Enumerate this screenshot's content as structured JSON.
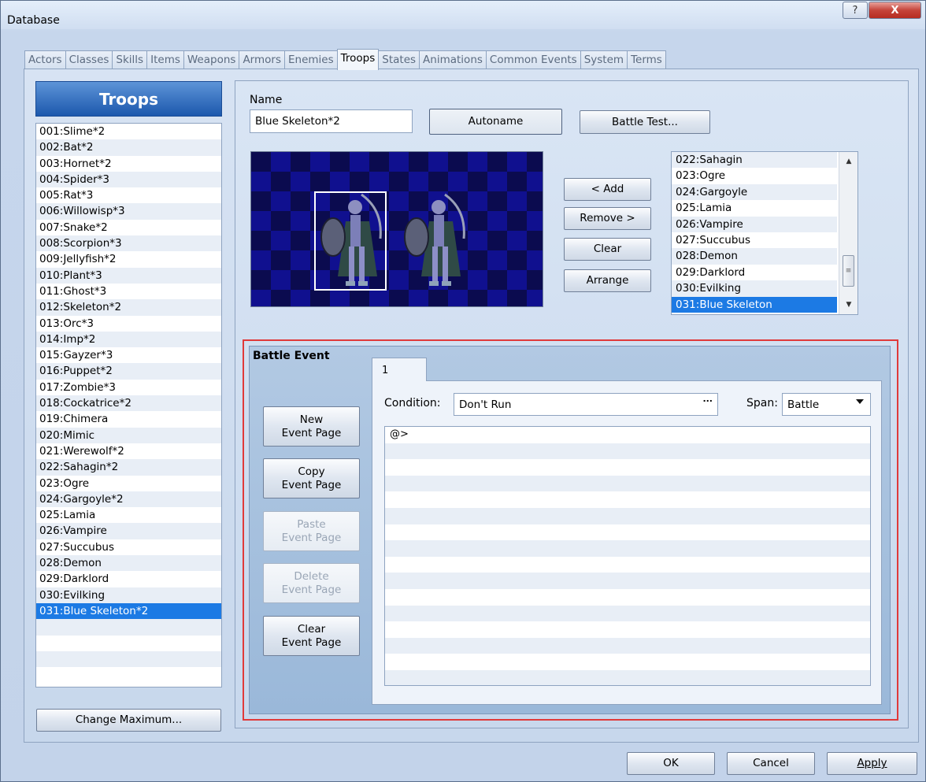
{
  "window": {
    "title": "Database",
    "help_label": "?",
    "close_label": "X"
  },
  "tabs": [
    {
      "label": "Actors",
      "active": false
    },
    {
      "label": "Classes",
      "active": false
    },
    {
      "label": "Skills",
      "active": false
    },
    {
      "label": "Items",
      "active": false
    },
    {
      "label": "Weapons",
      "active": false
    },
    {
      "label": "Armors",
      "active": false
    },
    {
      "label": "Enemies",
      "active": false
    },
    {
      "label": "Troops",
      "active": true
    },
    {
      "label": "States",
      "active": false
    },
    {
      "label": "Animations",
      "active": false
    },
    {
      "label": "Common Events",
      "active": false
    },
    {
      "label": "System",
      "active": false
    },
    {
      "label": "Terms",
      "active": false
    }
  ],
  "troop_list": {
    "header": "Troops",
    "items": [
      "001:Slime*2",
      "002:Bat*2",
      "003:Hornet*2",
      "004:Spider*3",
      "005:Rat*3",
      "006:Willowisp*3",
      "007:Snake*2",
      "008:Scorpion*3",
      "009:Jellyfish*2",
      "010:Plant*3",
      "011:Ghost*3",
      "012:Skeleton*2",
      "013:Orc*3",
      "014:Imp*2",
      "015:Gayzer*3",
      "016:Puppet*2",
      "017:Zombie*3",
      "018:Cockatrice*2",
      "019:Chimera",
      "020:Mimic",
      "021:Werewolf*2",
      "022:Sahagin*2",
      "023:Ogre",
      "024:Gargoyle*2",
      "025:Lamia",
      "026:Vampire",
      "027:Succubus",
      "028:Demon",
      "029:Darklord",
      "030:Evilking",
      "031:Blue Skeleton*2"
    ],
    "selected_index": 30,
    "change_max_label": "Change Maximum..."
  },
  "troop_editor": {
    "name_label": "Name",
    "name_value": "Blue Skeleton*2",
    "autoname_label": "Autoname",
    "battle_test_label": "Battle Test...",
    "add_label": "< Add",
    "remove_label": "Remove >",
    "clear_label": "Clear",
    "arrange_label": "Arrange"
  },
  "enemy_list": {
    "items": [
      "022:Sahagin",
      "023:Ogre",
      "024:Gargoyle",
      "025:Lamia",
      "026:Vampire",
      "027:Succubus",
      "028:Demon",
      "029:Darklord",
      "030:Evilking",
      "031:Blue Skeleton"
    ],
    "selected_index": 9
  },
  "battle_event": {
    "title": "Battle Event",
    "page_tab": "1",
    "new_page": "New\nEvent Page",
    "copy_page": "Copy\nEvent Page",
    "paste_page": "Paste\nEvent Page",
    "delete_page": "Delete\nEvent Page",
    "clear_page": "Clear\nEvent Page",
    "condition_label": "Condition:",
    "condition_value": "Don't Run",
    "condition_button": "...",
    "span_label": "Span:",
    "span_value": "Battle",
    "commands": [
      "@>"
    ]
  },
  "footer": {
    "ok": "OK",
    "cancel": "Cancel",
    "apply": "Apply"
  }
}
